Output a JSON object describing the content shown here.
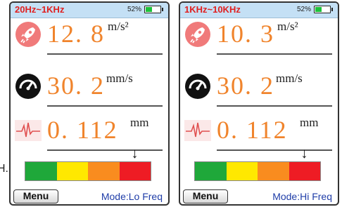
{
  "stray_text": "H.",
  "screens": [
    {
      "freq_range": "20Hz~1KHz",
      "battery": {
        "percent_label": "52%",
        "level": 0.52,
        "color": "#1cc23a"
      },
      "metrics": {
        "acceleration": {
          "value": "12. 8",
          "unit": "m/s²",
          "icon": "rocket-icon"
        },
        "velocity": {
          "value": "30. 2",
          "unit": "mm/s",
          "icon": "gauge-icon"
        },
        "displacement": {
          "value": "0. 112",
          "unit": "mm",
          "icon": "waveform-icon"
        }
      },
      "level_bar": {
        "colors": [
          "#1fa83a",
          "#ffe800",
          "#f98c1f",
          "#ee1c24"
        ],
        "indicator_segment": 4,
        "indicator": "down-arrow-icon"
      },
      "menu_label": "Menu",
      "mode": "Mode:Lo Freq"
    },
    {
      "freq_range": "1KHz~10KHz",
      "battery": {
        "percent_label": "52%",
        "level": 0.52,
        "color": "#1cc23a"
      },
      "metrics": {
        "acceleration": {
          "value": "10. 3",
          "unit": "m/s²",
          "icon": "rocket-icon"
        },
        "velocity": {
          "value": "30. 2",
          "unit": "mm/s",
          "icon": "gauge-icon"
        },
        "displacement": {
          "value": "0. 112",
          "unit": "mm",
          "icon": "waveform-icon"
        }
      },
      "level_bar": {
        "colors": [
          "#1fa83a",
          "#ffe800",
          "#f98c1f",
          "#ee1c24"
        ],
        "indicator_segment": 4,
        "indicator": "down-arrow-icon"
      },
      "menu_label": "Menu",
      "mode": "Mode:Hi Freq"
    }
  ]
}
